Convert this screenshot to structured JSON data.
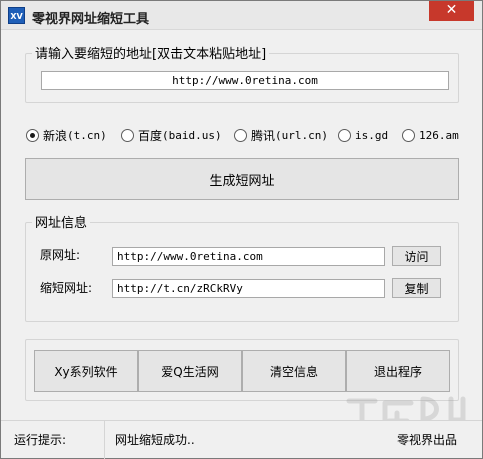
{
  "window": {
    "title": "零视界网址缩短工具",
    "app_icon_text": "XV",
    "close_glyph": "✕"
  },
  "input_group": {
    "label": "请输入要缩短的地址[双击文本粘贴地址]",
    "value": "http://www.0retina.com"
  },
  "services": [
    {
      "label": "新浪",
      "code": "(t.cn)",
      "selected": true
    },
    {
      "label": "百度",
      "code": "(baid.us)",
      "selected": false
    },
    {
      "label": "腾讯",
      "code": "(url.cn)",
      "selected": false
    },
    {
      "label": "",
      "code": "is.gd",
      "selected": false
    },
    {
      "label": "",
      "code": "126.am",
      "selected": false
    }
  ],
  "generate_button": "生成短网址",
  "info_group": {
    "label": "网址信息",
    "original_label": "原网址:",
    "original_value": "http://www.0retina.com",
    "visit_button": "访问",
    "short_label": "缩短网址:",
    "short_value": "http://t.cn/zRCkRVy",
    "copy_button": "复制"
  },
  "bottom_buttons": [
    "Xy系列软件",
    "爱Q生活网",
    "清空信息",
    "退出程序"
  ],
  "statusbar": {
    "label": "运行提示:",
    "message": "网址缩短成功..",
    "credit": "零视界出品"
  }
}
